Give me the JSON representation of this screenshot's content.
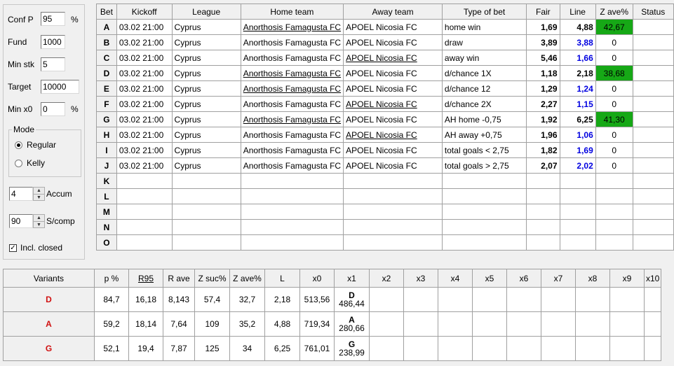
{
  "settings": {
    "conf_p_label": "Conf P",
    "conf_p_value": "95",
    "conf_p_unit": "%",
    "fund_label": "Fund",
    "fund_value": "1000",
    "min_stk_label": "Min stk",
    "min_stk_value": "5",
    "target_label": "Target",
    "target_value": "10000",
    "min_x0_label": "Min x0",
    "min_x0_value": "0",
    "min_x0_unit": "%",
    "mode_label": "Mode",
    "mode_regular": "Regular",
    "mode_kelly": "Kelly",
    "accum_value": "4",
    "accum_label": "Accum",
    "scomp_value": "90",
    "scomp_label": "S/comp",
    "incl_closed_label": "Incl. closed"
  },
  "bets_table": {
    "headers": [
      "Bet",
      "Kickoff",
      "League",
      "Home team",
      "Away team",
      "Type of bet",
      "Fair",
      "Line",
      "Z ave%",
      "Status"
    ],
    "rows": [
      {
        "bet": "A",
        "kickoff": "03.02 21:00",
        "league": "Cyprus",
        "home": "Anorthosis Famagusta FC",
        "away": "APOEL Nicosia FC",
        "type": "home win",
        "fair": "1,69",
        "line": "4,88",
        "zave": "42,67"
      },
      {
        "bet": "B",
        "kickoff": "03.02 21:00",
        "league": "Cyprus",
        "home": "Anorthosis Famagusta FC",
        "away": "APOEL Nicosia FC",
        "type": "draw",
        "fair": "3,89",
        "line": "3,88",
        "zave": "0"
      },
      {
        "bet": "C",
        "kickoff": "03.02 21:00",
        "league": "Cyprus",
        "home": "Anorthosis Famagusta FC",
        "away": "APOEL Nicosia FC",
        "type": "away win",
        "fair": "5,46",
        "line": "1,66",
        "zave": "0"
      },
      {
        "bet": "D",
        "kickoff": "03.02 21:00",
        "league": "Cyprus",
        "home": "Anorthosis Famagusta FC",
        "away": "APOEL Nicosia FC",
        "type": "d/chance 1X",
        "fair": "1,18",
        "line": "2,18",
        "zave": "38,68"
      },
      {
        "bet": "E",
        "kickoff": "03.02 21:00",
        "league": "Cyprus",
        "home": "Anorthosis Famagusta FC",
        "away": "APOEL Nicosia FC",
        "type": "d/chance 12",
        "fair": "1,29",
        "line": "1,24",
        "zave": "0"
      },
      {
        "bet": "F",
        "kickoff": "03.02 21:00",
        "league": "Cyprus",
        "home": "Anorthosis Famagusta FC",
        "away": "APOEL Nicosia FC",
        "type": "d/chance 2X",
        "fair": "2,27",
        "line": "1,15",
        "zave": "0"
      },
      {
        "bet": "G",
        "kickoff": "03.02 21:00",
        "league": "Cyprus",
        "home": "Anorthosis Famagusta FC",
        "away": "APOEL Nicosia FC",
        "type": "AH home -0,75",
        "fair": "1,92",
        "line": "6,25",
        "zave": "41,30"
      },
      {
        "bet": "H",
        "kickoff": "03.02 21:00",
        "league": "Cyprus",
        "home": "Anorthosis Famagusta FC",
        "away": "APOEL Nicosia FC",
        "type": "AH away +0,75",
        "fair": "1,96",
        "line": "1,06",
        "zave": "0"
      },
      {
        "bet": "I",
        "kickoff": "03.02 21:00",
        "league": "Cyprus",
        "home": "Anorthosis Famagusta FC",
        "away": "APOEL Nicosia FC",
        "type": "total goals < 2,75",
        "fair": "1,82",
        "line": "1,69",
        "zave": "0"
      },
      {
        "bet": "J",
        "kickoff": "03.02 21:00",
        "league": "Cyprus",
        "home": "Anorthosis Famagusta FC",
        "away": "APOEL Nicosia FC",
        "type": "total goals > 2,75",
        "fair": "2,07",
        "line": "2,02",
        "zave": "0"
      },
      {
        "bet": "K"
      },
      {
        "bet": "L"
      },
      {
        "bet": "M"
      },
      {
        "bet": "N"
      },
      {
        "bet": "O"
      }
    ]
  },
  "variants_table": {
    "headers": [
      "Variants",
      "p %",
      "R95",
      "R ave",
      "Z suc%",
      "Z ave%",
      "L",
      "x0",
      "x1",
      "x2",
      "x3",
      "x4",
      "x5",
      "x6",
      "x7",
      "x8",
      "x9",
      "x10"
    ],
    "rows": [
      {
        "variant": "D",
        "p": "84,7",
        "r95": "16,18",
        "rave": "8,143",
        "zsuc": "57,4",
        "zave": "32,7",
        "l": "2,18",
        "x0": "513,56",
        "x1_bet": "D",
        "x1_val": "486,44"
      },
      {
        "variant": "A",
        "p": "59,2",
        "r95": "18,14",
        "rave": "7,64",
        "zsuc": "109",
        "zave": "35,2",
        "l": "4,88",
        "x0": "719,34",
        "x1_bet": "A",
        "x1_val": "280,66"
      },
      {
        "variant": "G",
        "p": "52,1",
        "r95": "19,4",
        "rave": "7,87",
        "zsuc": "125",
        "zave": "34",
        "l": "6,25",
        "x0": "761,01",
        "x1_bet": "G",
        "x1_val": "238,99"
      }
    ]
  },
  "colors": {
    "highlight_green": "#16a816",
    "line_blue": "#0000e0",
    "variant_red": "#d01010"
  }
}
